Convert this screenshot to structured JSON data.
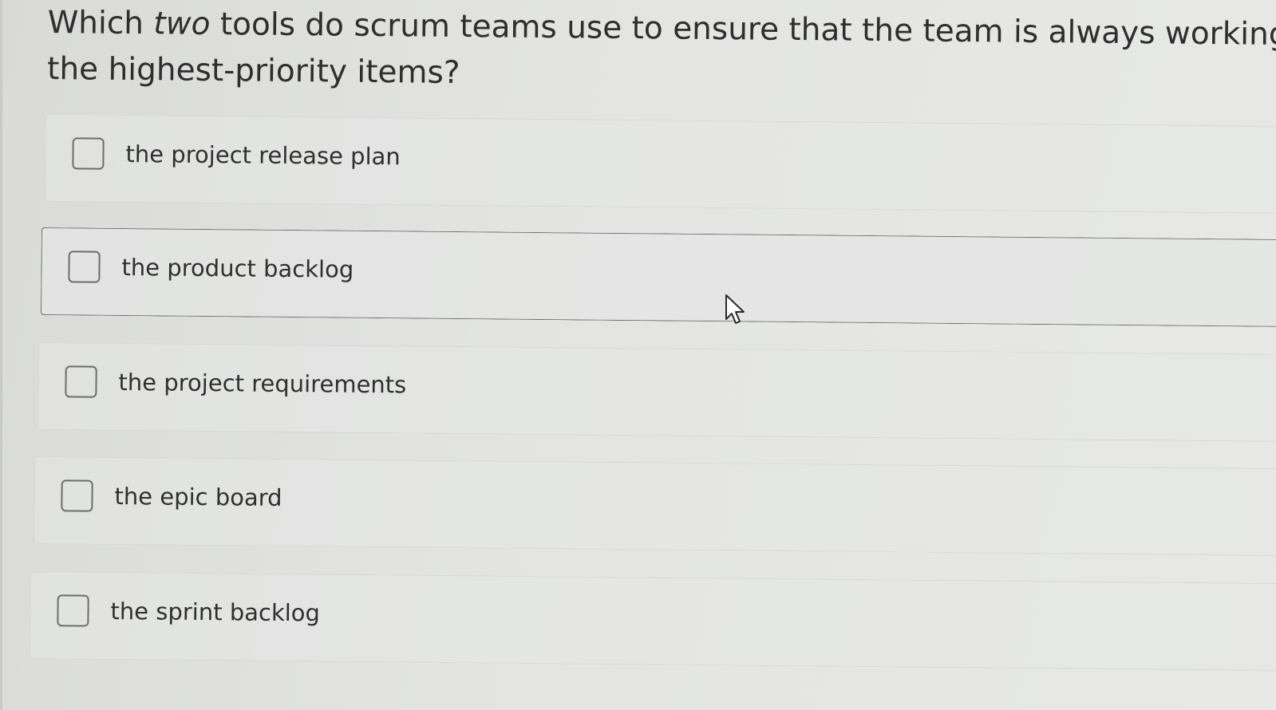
{
  "question": {
    "line1_before_em": "Which ",
    "line1_em": "two",
    "line1_after_em": " tools do scrum teams use to ensure that the team is always working on",
    "line2": "the highest-priority items?"
  },
  "options": [
    {
      "label": "the project release plan",
      "checked": false
    },
    {
      "label": "the product backlog",
      "checked": false,
      "hovered": true
    },
    {
      "label": "the project requirements",
      "checked": false
    },
    {
      "label": "the epic board",
      "checked": false
    },
    {
      "label": "the sprint backlog",
      "checked": false
    }
  ],
  "icons": {
    "cursor": "mouse-pointer-icon",
    "checkbox": "checkbox-icon"
  },
  "colors": {
    "background": "#e3e4e2",
    "text": "#2e2e2e",
    "checkbox_border": "#6c6c6c",
    "hover_border": "#6e6f6d"
  }
}
